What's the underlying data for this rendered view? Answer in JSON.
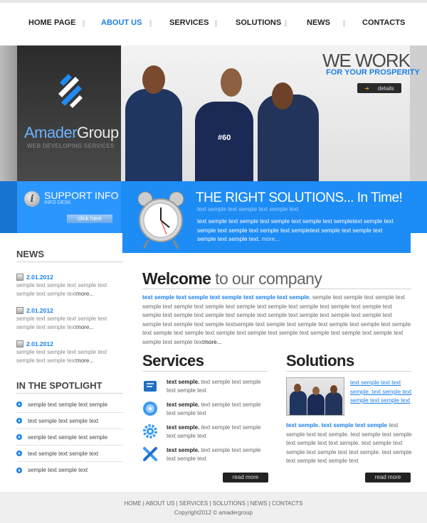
{
  "nav": {
    "items": [
      "HOME PAGE",
      "ABOUT US",
      "SERVICES",
      "SOLUTIONS",
      "NEWS",
      "CONTACTS"
    ],
    "active_color": "#1a7fe8"
  },
  "logo": {
    "brand_left": "Amader",
    "brand_right": "Group",
    "tagline": "WEB DEVELOPING SERVICES"
  },
  "hero": {
    "headline": "WE WORK",
    "subhead": "FOR YOUR PROSPERITY",
    "details_label": "details",
    "shirt_text": "#60"
  },
  "support": {
    "title": "SUPPORT INFO",
    "subtitle": "INFO DESK",
    "button": "click here"
  },
  "right_solutions": {
    "title": "THE RIGHT SOLUTIONS... In Time!",
    "subtitle": "text semple text semple text semple text",
    "body": "text semple text semple text semple text semple text sempletext semple text semple text semple text semple text sempletext semple text semple text semple text semple text.",
    "more": "more..."
  },
  "news": {
    "title": "NEWS",
    "items": [
      {
        "date": "2.01.2012",
        "text": "semple text semple text semple text semple text semple text",
        "more": "more..."
      },
      {
        "date": "2.01.2012",
        "text": "semple text semple text semple text semple text semple text",
        "more": "more..."
      },
      {
        "date": "2.01.2012",
        "text": "semple text semple text semple text semple text semple text",
        "more": "more..."
      }
    ]
  },
  "spotlight": {
    "title": "IN THE SPOTLIGHT",
    "items": [
      "semple text semple text semple",
      "text semple text semple text",
      "semple text semple text semple",
      "text semple text semple text",
      "semple text semple text"
    ]
  },
  "welcome": {
    "bold": "Welcome",
    "rest": " to our company",
    "lead": "text semple text semple text semple text semple text semple.",
    "body": " semple text semple text semple text semple text semple text semple text semple text semple text semple text semple text semple text semple text semple text semple text semple text semple text semple text semple text semple text semple text semple text semple textsemple text semple text semple text semple text semple text semple text semple text semple text semple text semple text semple text semple text semple text semple text semple text semple text",
    "more": "more..."
  },
  "services": {
    "title": "Services",
    "items": [
      {
        "icon": "book-icon",
        "bold": "text semple.",
        "text": " text semple text semple text semple text"
      },
      {
        "icon": "disc-icon",
        "bold": "text semple.",
        "text": " text semple text semple text semple text"
      },
      {
        "icon": "gear-icon",
        "bold": "text semple.",
        "text": " text semple text semple text semple text"
      },
      {
        "icon": "tools-icon",
        "bold": "text semple.",
        "text": " text semple text semple text semple text"
      }
    ],
    "read_more": "read more"
  },
  "solutions": {
    "title": "Solutions",
    "links": "text semple text text semple. text semple text semple text semple text",
    "lead": "text semple. text semple text semple",
    "body": " text semple text text semple. text semple text semple text semple text text semple. text semple text semple text semple text text semple. text semple text semple text semple text",
    "read_more": "read more"
  },
  "footer": {
    "links": [
      "HOME",
      "ABOUT US",
      "SERVICES",
      "SOLUTIONS",
      "NEWS",
      "CONTACTS"
    ],
    "copyright": "Copyright2012 © amadergroup"
  },
  "colors": {
    "accent": "#1a7fe8",
    "blue_panel": "#1e8cf5",
    "dark": "#222222"
  }
}
